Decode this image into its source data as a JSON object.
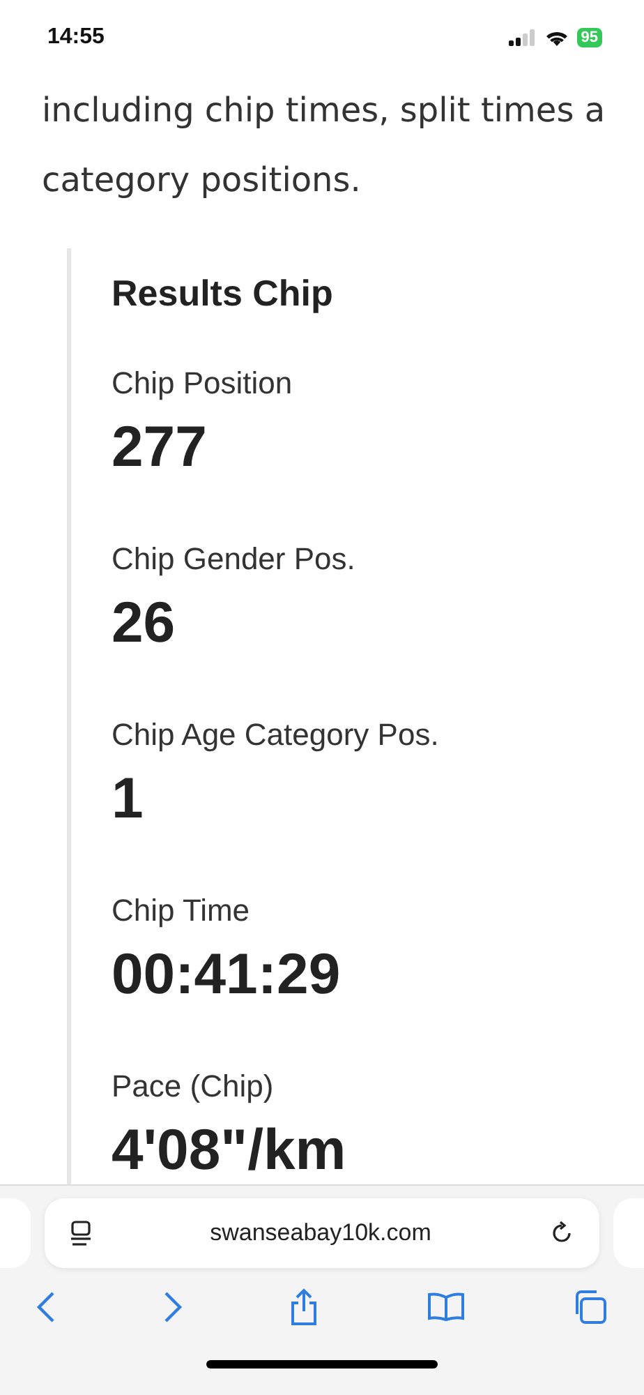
{
  "status_bar": {
    "time": "14:55",
    "battery": "95"
  },
  "intro_lines": [
    "including chip times, split times a",
    "category positions."
  ],
  "results": {
    "title": "Results Chip",
    "items": [
      {
        "label": "Chip Position",
        "value": "277"
      },
      {
        "label": "Chip Gender Pos.",
        "value": "26"
      },
      {
        "label": "Chip Age Category Pos.",
        "value": "1"
      },
      {
        "label": "Chip Time",
        "value": "00:41:29"
      },
      {
        "label": "Pace (Chip)",
        "value": "4'08\"/km"
      }
    ]
  },
  "browser": {
    "url": "swanseabay10k.com"
  }
}
